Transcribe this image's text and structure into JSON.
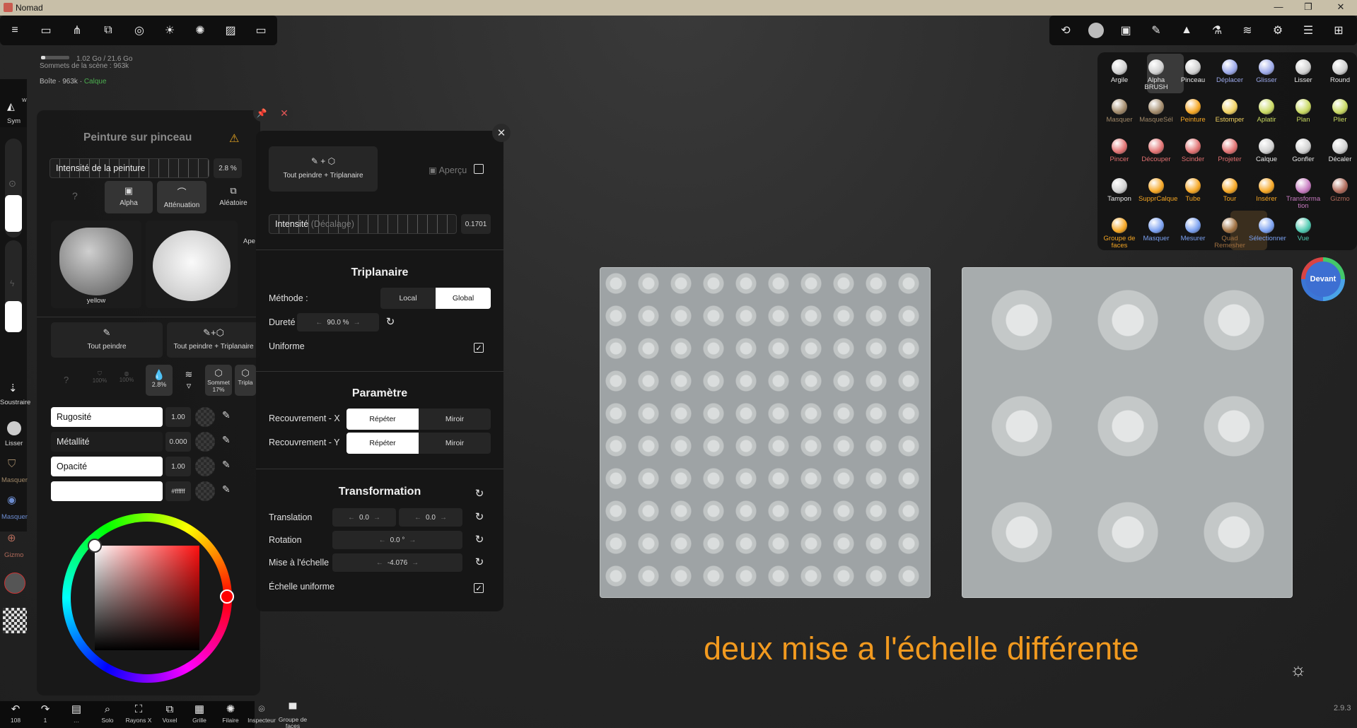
{
  "window": {
    "title": "Nomad"
  },
  "stats": {
    "memory": "1.02 Go / 21.6 Go",
    "vertices": "Sommets de la scène : 963k",
    "object": "Boîte · 963k ·",
    "layer": "Calque"
  },
  "left_sidebar": {
    "sym": "Sym",
    "sym_badge": "W",
    "soustraire": "Soustraire",
    "lisser": "Lisser",
    "masquer1": "Masquer",
    "masquer2": "Masquer",
    "gizmo": "Gizmo"
  },
  "paint_panel": {
    "title": "Peinture sur pinceau",
    "intensity_label": "Intensité de la peinture",
    "intensity_value": "2.8 %",
    "tabs": [
      "Alpha",
      "Atténuation",
      "Aléatoire"
    ],
    "alpha_name": "yellow",
    "ape": "Ape",
    "paint_all": "Tout peindre",
    "paint_all_tri": "Tout peindre + Triplanaire",
    "mini_icons": [
      "100%",
      "100%",
      "2.8%",
      "",
      "Sommet 17%",
      "Tripla"
    ],
    "rugosite_label": "Rugosité",
    "rugosite_value": "1.00",
    "metallite_label": "Métallité",
    "metallite_value": "0.000",
    "opacite_label": "Opacité",
    "opacite_value": "1.00",
    "color_hex": "#ffffff"
  },
  "tri_panel": {
    "top_button_label": "Tout peindre + Triplanaire",
    "preview_label": "Aperçu",
    "intensity_label": "Intensité",
    "intensity_sub": "(Décalage)",
    "intensity_value": "0.1701",
    "triplanaire": {
      "title": "Triplanaire",
      "methode_label": "Méthode :",
      "local": "Local",
      "global": "Global",
      "durete_label": "Dureté",
      "durete_value": "90.0 %",
      "uniforme_label": "Uniforme"
    },
    "parametre": {
      "title": "Paramètre",
      "rx_label": "Recouvrement - X",
      "ry_label": "Recouvrement - Y",
      "repeat": "Répéter",
      "mirror": "Miroir"
    },
    "transformation": {
      "title": "Transformation",
      "translation_label": "Translation",
      "translation_x": "0.0",
      "translation_y": "0.0",
      "rotation_label": "Rotation",
      "rotation_value": "0.0 °",
      "scale_label": "Mise à l'échelle",
      "scale_value": "-4.076",
      "uniform_scale_label": "Échelle uniforme"
    }
  },
  "tools": {
    "rows": [
      [
        "Argile",
        "Alpha BRUSH",
        "Pinceau",
        "Déplacer",
        "Glisser",
        "Lisser",
        "Round"
      ],
      [
        "Masquer",
        "MasqueSél",
        "Peinture",
        "Estomper",
        "Aplatir",
        "Plan",
        "Plier"
      ],
      [
        "Pincer",
        "Découper",
        "Scinder",
        "Projeter",
        "Calque",
        "Gonfler",
        "Décaler"
      ],
      [
        "Tampon",
        "SupprCalque",
        "Tube",
        "Tour",
        "Insérer",
        "Transforma tion",
        "Gizmo"
      ],
      [
        "Groupe de faces",
        "Masquer",
        "Mesurer",
        "Quad Remesher",
        "Sélectionner",
        "Vue",
        ""
      ]
    ]
  },
  "view_cube": {
    "label": "Devant"
  },
  "caption": "deux mise a l'échelle différente",
  "version": "2.9.3",
  "bottom_bar": {
    "undo_count": "108",
    "redo_count": "1",
    "items": [
      "Solo",
      "Rayons X",
      "Voxel",
      "Grille",
      "Filaire",
      "Inspecteur",
      "Groupe de faces"
    ]
  },
  "colors": {
    "accent_orange": "#f29a1f",
    "panel_bg": "#161616",
    "active_white": "#ffffff"
  }
}
